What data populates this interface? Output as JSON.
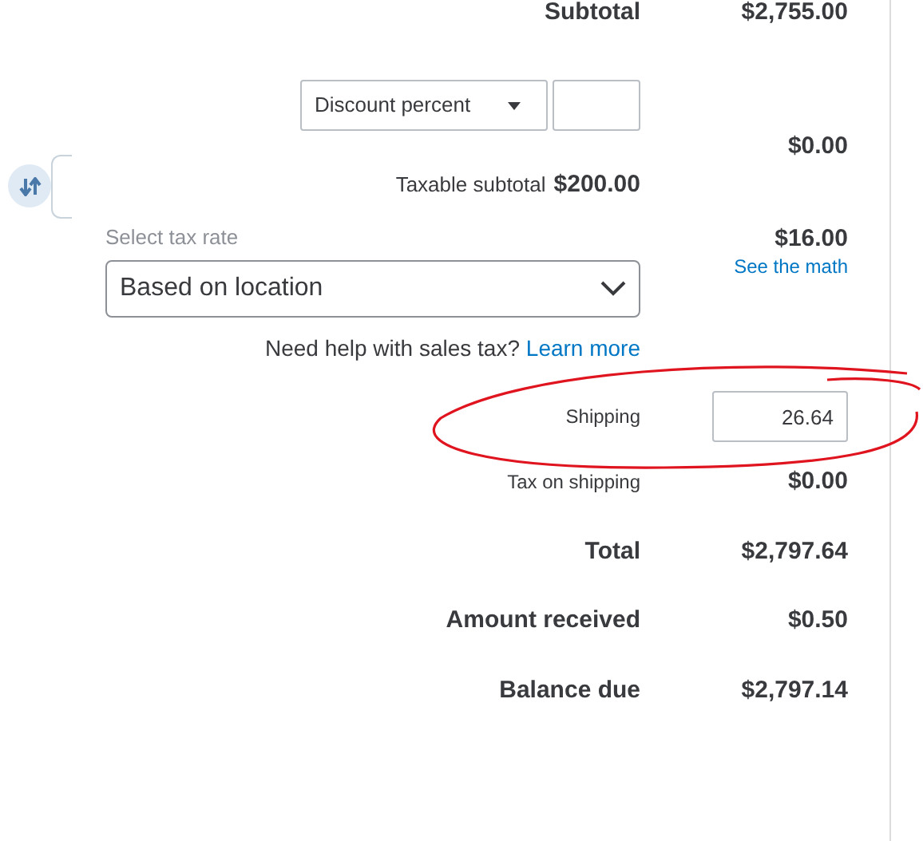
{
  "subtotal": {
    "label": "Subtotal",
    "amount": "$2,755.00"
  },
  "discount": {
    "type": "Discount percent",
    "amount": "$0.00"
  },
  "taxable_subtotal": {
    "label": "Taxable subtotal",
    "amount": "$200.00"
  },
  "tax": {
    "label": "Select tax rate",
    "rate": "Based on location",
    "amount": "$16.00",
    "math_link": "See the math"
  },
  "help": {
    "text": "Need help with sales tax?",
    "link": "Learn more"
  },
  "shipping": {
    "label": "Shipping",
    "value": "26.64"
  },
  "totals": [
    {
      "kind": "small",
      "label": "Tax on shipping",
      "amount": "$0.00"
    },
    {
      "kind": "large",
      "label": "Total",
      "amount": "$2,797.64"
    },
    {
      "kind": "large",
      "label": "Amount received",
      "amount": "$0.50"
    },
    {
      "kind": "large",
      "label": "Balance due",
      "amount": "$2,797.14"
    }
  ]
}
